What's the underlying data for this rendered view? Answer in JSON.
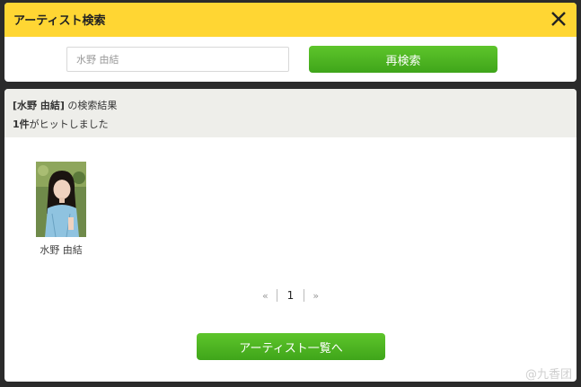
{
  "header": {
    "title": "アーティスト検索"
  },
  "search": {
    "value": "水野 由結",
    "placeholder": "水野 由結",
    "button_label": "再検索"
  },
  "results": {
    "keyword": "[水野 由結]",
    "keyword_suffix": " の検索結果",
    "count": "1件",
    "count_suffix": "がヒットしました",
    "artists": [
      {
        "name": "水野 由結"
      }
    ]
  },
  "pagination": {
    "prev": "«",
    "current": "1",
    "next": "»"
  },
  "footer": {
    "list_button_label": "アーティスト一覧へ"
  },
  "watermark": "@九香团",
  "colors": {
    "header_bg": "#ffd633",
    "button_green": "#4ab51f",
    "result_head_bg": "#eeeeea"
  }
}
